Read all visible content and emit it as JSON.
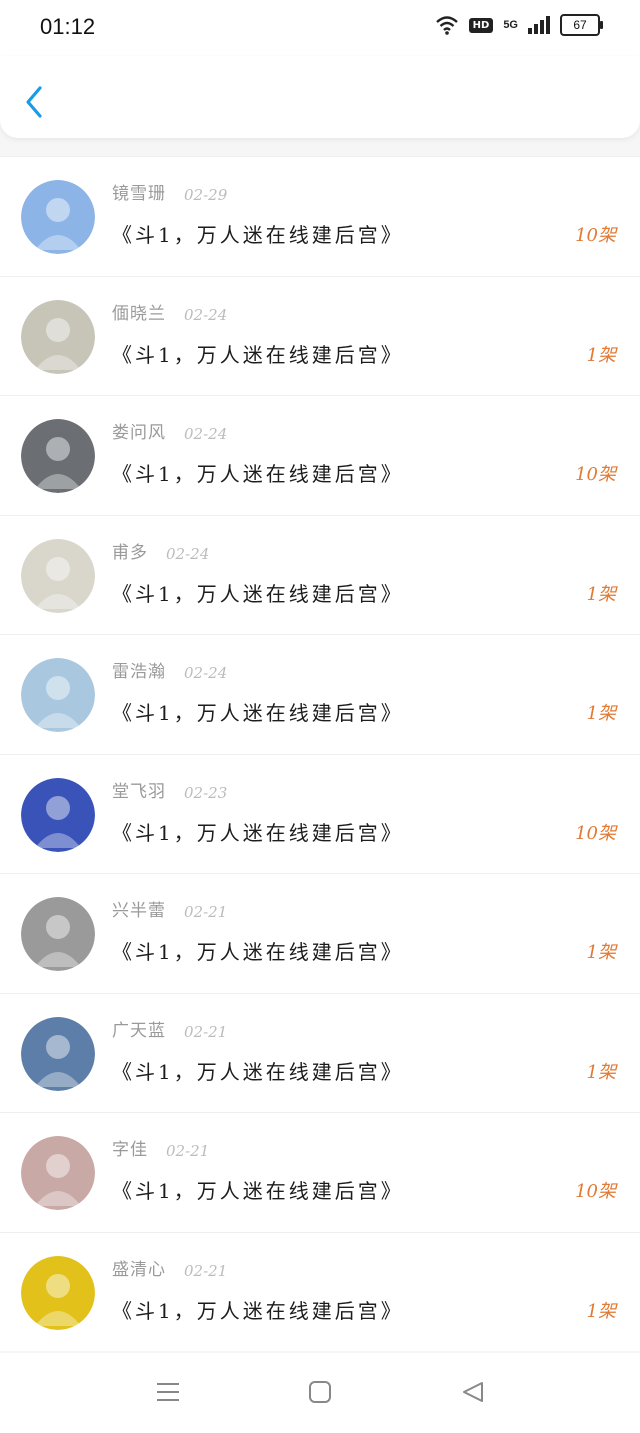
{
  "status_bar": {
    "time": "01:12",
    "network": "5G",
    "hd": "HD",
    "battery": "67"
  },
  "header": {
    "back_icon": "chevron-left-icon",
    "accent": "#1a9be8"
  },
  "list": [
    {
      "nickname": "镜雪珊",
      "date": "02-29",
      "title": "《斗1，万人迷在线建后宫》",
      "count": "10架",
      "avatar_color": "#8db4e6"
    },
    {
      "nickname": "偭晓兰",
      "date": "02-24",
      "title": "《斗1，万人迷在线建后宫》",
      "count": "1架",
      "avatar_color": "#c7c4b8"
    },
    {
      "nickname": "娄问风",
      "date": "02-24",
      "title": "《斗1，万人迷在线建后宫》",
      "count": "10架",
      "avatar_color": "#6b6f74"
    },
    {
      "nickname": "甫多",
      "date": "02-24",
      "title": "《斗1，万人迷在线建后宫》",
      "count": "1架",
      "avatar_color": "#d9d6cc"
    },
    {
      "nickname": "雷浩瀚",
      "date": "02-24",
      "title": "《斗1，万人迷在线建后宫》",
      "count": "1架",
      "avatar_color": "#a9c8e0"
    },
    {
      "nickname": "堂飞羽",
      "date": "02-23",
      "title": "《斗1，万人迷在线建后宫》",
      "count": "10架",
      "avatar_color": "#3a53b8"
    },
    {
      "nickname": "兴半蕾",
      "date": "02-21",
      "title": "《斗1，万人迷在线建后宫》",
      "count": "1架",
      "avatar_color": "#9a9a9a"
    },
    {
      "nickname": "广天蓝",
      "date": "02-21",
      "title": "《斗1，万人迷在线建后宫》",
      "count": "1架",
      "avatar_color": "#5d7ea8"
    },
    {
      "nickname": "字佳",
      "date": "02-21",
      "title": "《斗1，万人迷在线建后宫》",
      "count": "10架",
      "avatar_color": "#c8a9a6"
    },
    {
      "nickname": "盛清心",
      "date": "02-21",
      "title": "《斗1，万人迷在线建后宫》",
      "count": "1架",
      "avatar_color": "#e2c21a"
    }
  ],
  "nav_bar": {
    "menu_icon": "menu-icon",
    "home_icon": "home-icon",
    "back_icon": "back-triangle-icon"
  }
}
